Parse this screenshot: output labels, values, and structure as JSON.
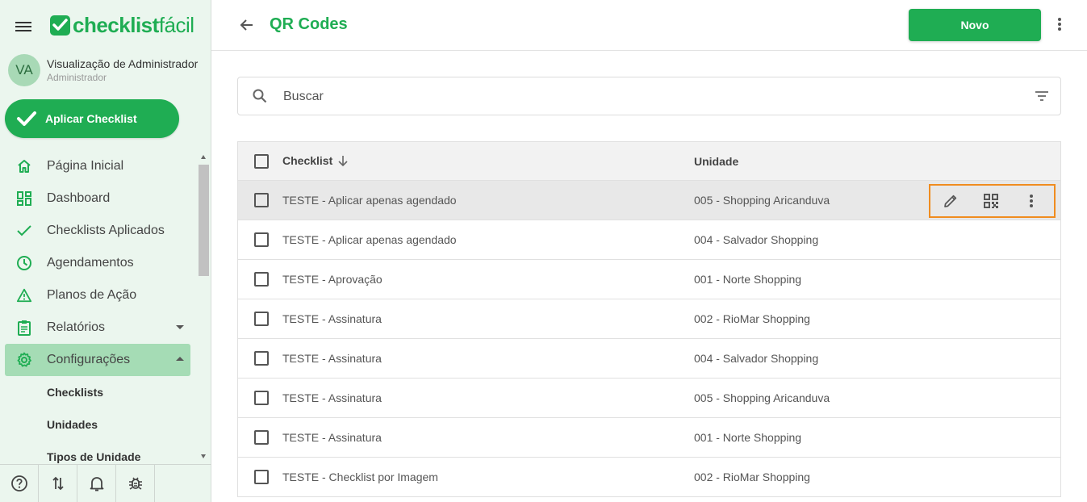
{
  "sidebar": {
    "logo_bold": "checklist",
    "logo_light": "fácil",
    "user": {
      "initials": "VA",
      "name": "Visualização de Administrador",
      "role": "Administrador"
    },
    "apply_label": "Aplicar Checklist",
    "nav": [
      {
        "label": "Página Inicial",
        "icon": "home-icon"
      },
      {
        "label": "Dashboard",
        "icon": "dashboard-icon"
      },
      {
        "label": "Checklists Aplicados",
        "icon": "check-icon"
      },
      {
        "label": "Agendamentos",
        "icon": "clock-icon"
      },
      {
        "label": "Planos de Ação",
        "icon": "warning-icon"
      },
      {
        "label": "Relatórios",
        "icon": "clipboard-icon"
      },
      {
        "label": "Configurações",
        "icon": "gear-icon"
      }
    ],
    "sub_items": [
      "Checklists",
      "Unidades",
      "Tipos de Unidade"
    ],
    "bottom_icons": [
      "help-icon",
      "sort-icon",
      "bell-icon",
      "bug-icon"
    ]
  },
  "header": {
    "title": "QR Codes",
    "new_label": "Novo"
  },
  "search": {
    "placeholder": "Buscar"
  },
  "table": {
    "columns": [
      "Checklist",
      "Unidade"
    ],
    "rows": [
      {
        "checklist": "TESTE - Aplicar apenas agendado",
        "unit": "005 - Shopping Aricanduva"
      },
      {
        "checklist": "TESTE - Aplicar apenas agendado",
        "unit": "004 - Salvador Shopping"
      },
      {
        "checklist": "TESTE - Aprovação",
        "unit": "001 - Norte Shopping"
      },
      {
        "checklist": "TESTE - Assinatura",
        "unit": "002 - RioMar Shopping"
      },
      {
        "checklist": "TESTE - Assinatura",
        "unit": "004 - Salvador Shopping"
      },
      {
        "checklist": "TESTE - Assinatura",
        "unit": "005 - Shopping Aricanduva"
      },
      {
        "checklist": "TESTE - Assinatura",
        "unit": "001 - Norte Shopping"
      },
      {
        "checklist": "TESTE - Checklist por Imagem",
        "unit": "002 - RioMar Shopping"
      }
    ]
  },
  "colors": {
    "brand": "#1fad53",
    "highlight": "#f08c1f",
    "sidebar_bg": "#ebf6ee",
    "active_bg": "#a5dcb5"
  }
}
